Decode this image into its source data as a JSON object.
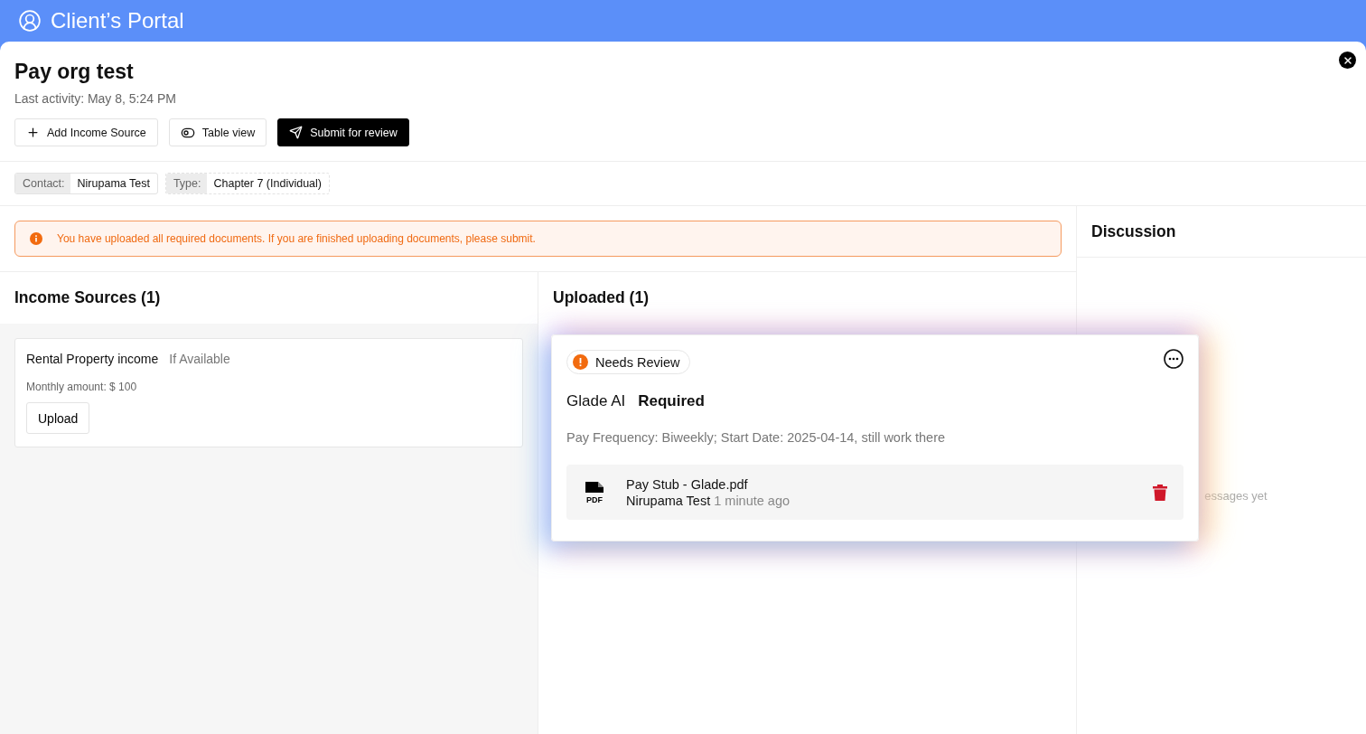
{
  "app": {
    "title": "Client’s Portal"
  },
  "case": {
    "title": "Pay org test",
    "last_activity": "Last activity: May 8, 5:24 PM"
  },
  "actions": [
    {
      "kind": "add",
      "label": "Add Income Source",
      "primary": false
    },
    {
      "kind": "toggle",
      "label": "Table view",
      "primary": false
    },
    {
      "kind": "send",
      "label": "Submit for review",
      "primary": true
    }
  ],
  "meta": [
    {
      "label": "Contact:",
      "value": "Nirupama Test",
      "dashed": false
    },
    {
      "label": "Type:",
      "value": "Chapter 7 (Individual)",
      "dashed": true
    }
  ],
  "alert": {
    "text": "You have uploaded all required documents. If you are finished uploading documents, please submit."
  },
  "income_sources": {
    "title": "Income Sources (1)",
    "items": [
      {
        "name": "Rental Property income",
        "tag": "If Available",
        "amount": "Monthly amount: $ 100",
        "button": "Upload"
      }
    ]
  },
  "uploaded": {
    "title": "Uploaded (1)"
  },
  "discussion": {
    "title": "Discussion",
    "empty_text": "essages yet"
  },
  "upload_card": {
    "status": "Needs Review",
    "source": "Glade AI",
    "requirement": "Required",
    "note": "Pay Frequency: Biweekly; Start Date: 2025-04-14, still work there",
    "file": {
      "icon_text": "PDF",
      "name": "Pay Stub - Glade.pdf",
      "uploader": "Nirupama Test",
      "time": "1 minute ago"
    }
  }
}
